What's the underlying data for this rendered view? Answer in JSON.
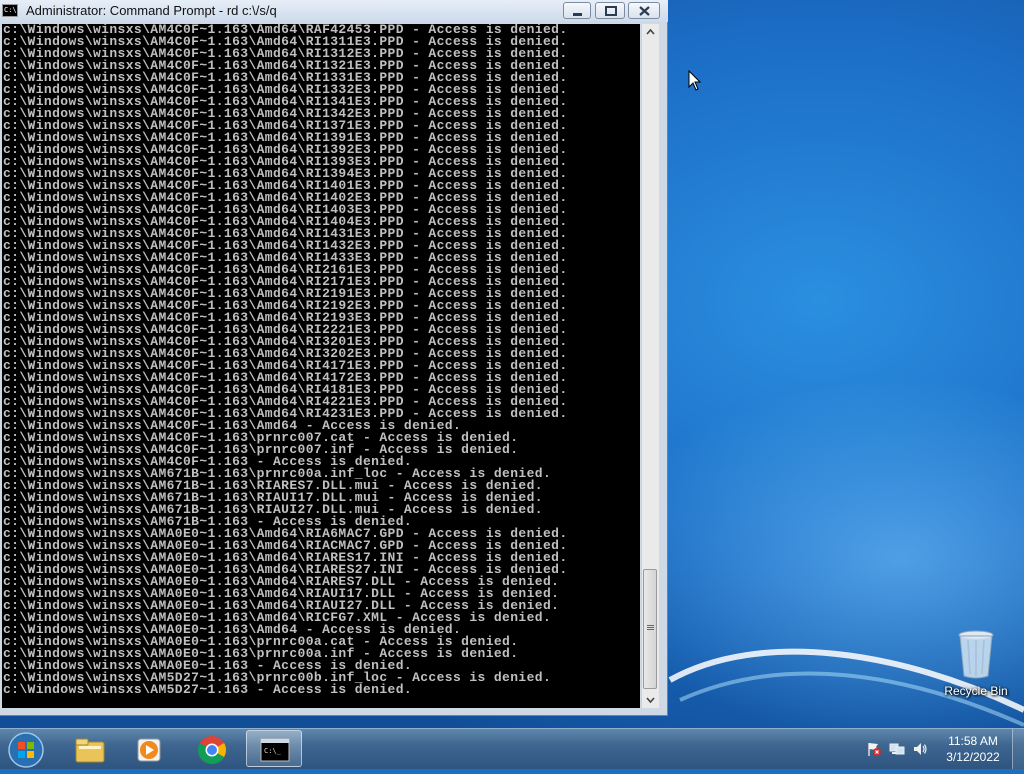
{
  "window": {
    "title": "Administrator: Command Prompt - rd  c:\\/s/q",
    "icon_text": "C:\\"
  },
  "console_lines": [
    "c:\\Windows\\winsxs\\AM4C0F~1.163\\Amd64\\RAF42453.PPD - Access is denied.",
    "c:\\Windows\\winsxs\\AM4C0F~1.163\\Amd64\\RI1311E3.PPD - Access is denied.",
    "c:\\Windows\\winsxs\\AM4C0F~1.163\\Amd64\\RI1312E3.PPD - Access is denied.",
    "c:\\Windows\\winsxs\\AM4C0F~1.163\\Amd64\\RI1321E3.PPD - Access is denied.",
    "c:\\Windows\\winsxs\\AM4C0F~1.163\\Amd64\\RI1331E3.PPD - Access is denied.",
    "c:\\Windows\\winsxs\\AM4C0F~1.163\\Amd64\\RI1332E3.PPD - Access is denied.",
    "c:\\Windows\\winsxs\\AM4C0F~1.163\\Amd64\\RI1341E3.PPD - Access is denied.",
    "c:\\Windows\\winsxs\\AM4C0F~1.163\\Amd64\\RI1342E3.PPD - Access is denied.",
    "c:\\Windows\\winsxs\\AM4C0F~1.163\\Amd64\\RI1371E3.PPD - Access is denied.",
    "c:\\Windows\\winsxs\\AM4C0F~1.163\\Amd64\\RI1391E3.PPD - Access is denied.",
    "c:\\Windows\\winsxs\\AM4C0F~1.163\\Amd64\\RI1392E3.PPD - Access is denied.",
    "c:\\Windows\\winsxs\\AM4C0F~1.163\\Amd64\\RI1393E3.PPD - Access is denied.",
    "c:\\Windows\\winsxs\\AM4C0F~1.163\\Amd64\\RI1394E3.PPD - Access is denied.",
    "c:\\Windows\\winsxs\\AM4C0F~1.163\\Amd64\\RI1401E3.PPD - Access is denied.",
    "c:\\Windows\\winsxs\\AM4C0F~1.163\\Amd64\\RI1402E3.PPD - Access is denied.",
    "c:\\Windows\\winsxs\\AM4C0F~1.163\\Amd64\\RI1403E3.PPD - Access is denied.",
    "c:\\Windows\\winsxs\\AM4C0F~1.163\\Amd64\\RI1404E3.PPD - Access is denied.",
    "c:\\Windows\\winsxs\\AM4C0F~1.163\\Amd64\\RI1431E3.PPD - Access is denied.",
    "c:\\Windows\\winsxs\\AM4C0F~1.163\\Amd64\\RI1432E3.PPD - Access is denied.",
    "c:\\Windows\\winsxs\\AM4C0F~1.163\\Amd64\\RI1433E3.PPD - Access is denied.",
    "c:\\Windows\\winsxs\\AM4C0F~1.163\\Amd64\\RI2161E3.PPD - Access is denied.",
    "c:\\Windows\\winsxs\\AM4C0F~1.163\\Amd64\\RI2171E3.PPD - Access is denied.",
    "c:\\Windows\\winsxs\\AM4C0F~1.163\\Amd64\\RI2191E3.PPD - Access is denied.",
    "c:\\Windows\\winsxs\\AM4C0F~1.163\\Amd64\\RI2192E3.PPD - Access is denied.",
    "c:\\Windows\\winsxs\\AM4C0F~1.163\\Amd64\\RI2193E3.PPD - Access is denied.",
    "c:\\Windows\\winsxs\\AM4C0F~1.163\\Amd64\\RI2221E3.PPD - Access is denied.",
    "c:\\Windows\\winsxs\\AM4C0F~1.163\\Amd64\\RI3201E3.PPD - Access is denied.",
    "c:\\Windows\\winsxs\\AM4C0F~1.163\\Amd64\\RI3202E3.PPD - Access is denied.",
    "c:\\Windows\\winsxs\\AM4C0F~1.163\\Amd64\\RI4171E3.PPD - Access is denied.",
    "c:\\Windows\\winsxs\\AM4C0F~1.163\\Amd64\\RI4172E3.PPD - Access is denied.",
    "c:\\Windows\\winsxs\\AM4C0F~1.163\\Amd64\\RI4181E3.PPD - Access is denied.",
    "c:\\Windows\\winsxs\\AM4C0F~1.163\\Amd64\\RI4221E3.PPD - Access is denied.",
    "c:\\Windows\\winsxs\\AM4C0F~1.163\\Amd64\\RI4231E3.PPD - Access is denied.",
    "c:\\Windows\\winsxs\\AM4C0F~1.163\\Amd64 - Access is denied.",
    "c:\\Windows\\winsxs\\AM4C0F~1.163\\prnrc007.cat - Access is denied.",
    "c:\\Windows\\winsxs\\AM4C0F~1.163\\prnrc007.inf - Access is denied.",
    "c:\\Windows\\winsxs\\AM4C0F~1.163 - Access is denied.",
    "c:\\Windows\\winsxs\\AM671B~1.163\\prnrc00a.inf_loc - Access is denied.",
    "c:\\Windows\\winsxs\\AM671B~1.163\\RIARES7.DLL.mui - Access is denied.",
    "c:\\Windows\\winsxs\\AM671B~1.163\\RIAUI17.DLL.mui - Access is denied.",
    "c:\\Windows\\winsxs\\AM671B~1.163\\RIAUI27.DLL.mui - Access is denied.",
    "c:\\Windows\\winsxs\\AM671B~1.163 - Access is denied.",
    "c:\\Windows\\winsxs\\AMA0E0~1.163\\Amd64\\RIA6MAC7.GPD - Access is denied.",
    "c:\\Windows\\winsxs\\AMA0E0~1.163\\Amd64\\RIACMAC7.GPD - Access is denied.",
    "c:\\Windows\\winsxs\\AMA0E0~1.163\\Amd64\\RIARES17.INI - Access is denied.",
    "c:\\Windows\\winsxs\\AMA0E0~1.163\\Amd64\\RIARES27.INI - Access is denied.",
    "c:\\Windows\\winsxs\\AMA0E0~1.163\\Amd64\\RIARES7.DLL - Access is denied.",
    "c:\\Windows\\winsxs\\AMA0E0~1.163\\Amd64\\RIAUI17.DLL - Access is denied.",
    "c:\\Windows\\winsxs\\AMA0E0~1.163\\Amd64\\RIAUI27.DLL - Access is denied.",
    "c:\\Windows\\winsxs\\AMA0E0~1.163\\Amd64\\RICFG7.XML - Access is denied.",
    "c:\\Windows\\winsxs\\AMA0E0~1.163\\Amd64 - Access is denied.",
    "c:\\Windows\\winsxs\\AMA0E0~1.163\\prnrc00a.cat - Access is denied.",
    "c:\\Windows\\winsxs\\AMA0E0~1.163\\prnrc00a.inf - Access is denied.",
    "c:\\Windows\\winsxs\\AMA0E0~1.163 - Access is denied.",
    "c:\\Windows\\winsxs\\AM5D27~1.163\\prnrc00b.inf_loc - Access is denied.",
    "c:\\Windows\\winsxs\\AM5D27~1.163 - Access is denied."
  ],
  "scrollbar": {
    "position": 0.9
  },
  "desktop": {
    "icons": [
      {
        "label": "Recycle Bin",
        "icon": "recycle-bin-icon"
      }
    ]
  },
  "taskbar": {
    "items": [
      {
        "name": "Windows Explorer",
        "icon": "folder-icon",
        "active": false
      },
      {
        "name": "Windows Media Player",
        "icon": "media-player-icon",
        "active": false
      },
      {
        "name": "Google Chrome",
        "icon": "chrome-icon",
        "active": false
      },
      {
        "name": "Command Prompt",
        "icon": "cmd-icon",
        "active": true
      }
    ],
    "clock": {
      "time": "11:58 AM",
      "date": "3/12/2022"
    },
    "tray_icons": [
      "action-center-flag-icon",
      "network-icon",
      "volume-icon"
    ]
  },
  "colors": {
    "console_bg": "#000000",
    "console_fg": "#c0c0c0",
    "desktop_blue": "#1b6cc4",
    "taskbar": "#3e6690"
  }
}
